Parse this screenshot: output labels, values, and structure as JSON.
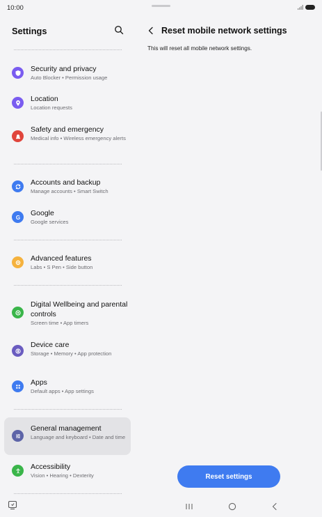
{
  "status": {
    "time": "10:00"
  },
  "settings": {
    "title": "Settings",
    "items": [
      {
        "title": "Security and privacy",
        "subtitle": "Auto Blocker  •  Permission usage",
        "icon": "shield-icon",
        "color": "#7a5cf0"
      },
      {
        "title": "Location",
        "subtitle": "Location requests",
        "icon": "location-pin-icon",
        "color": "#7a5cf0"
      },
      {
        "title": "Safety and emergency",
        "subtitle": "Medical info  •  Wireless emergency alerts",
        "icon": "alert-bell-icon",
        "color": "#e0453c"
      },
      {
        "title": "Accounts and backup",
        "subtitle": "Manage accounts  •  Smart Switch",
        "icon": "sync-icon",
        "color": "#3f7bf0"
      },
      {
        "title": "Google",
        "subtitle": "Google services",
        "icon": "google-icon",
        "color": "#3f7bf0"
      },
      {
        "title": "Advanced features",
        "subtitle": "Labs  •  S Pen  •  Side button",
        "icon": "gear-plus-icon",
        "color": "#f5b23e"
      },
      {
        "title": "Digital Wellbeing and parental controls",
        "subtitle": "Screen time  •  App timers",
        "icon": "wellbeing-icon",
        "color": "#3ab54a"
      },
      {
        "title": "Device care",
        "subtitle": "Storage  •  Memory  •  App protection",
        "icon": "device-care-icon",
        "color": "#6a5cc0"
      },
      {
        "title": "Apps",
        "subtitle": "Default apps  •  App settings",
        "icon": "apps-grid-icon",
        "color": "#3f7bf0"
      },
      {
        "title": "General management",
        "subtitle": "Language and keyboard  •  Date and time",
        "icon": "sliders-icon",
        "color": "#5d64a8"
      },
      {
        "title": "Accessibility",
        "subtitle": "Vision  •  Hearing  •  Dexterity",
        "icon": "accessibility-icon",
        "color": "#3ab54a"
      }
    ]
  },
  "detail": {
    "title": "Reset mobile network settings",
    "description": "This will reset all mobile network settings.",
    "button_label": "Reset settings"
  },
  "colors": {
    "accent": "#3f7bf0",
    "background": "#f4f4f6",
    "selected": "#e3e3e6"
  }
}
